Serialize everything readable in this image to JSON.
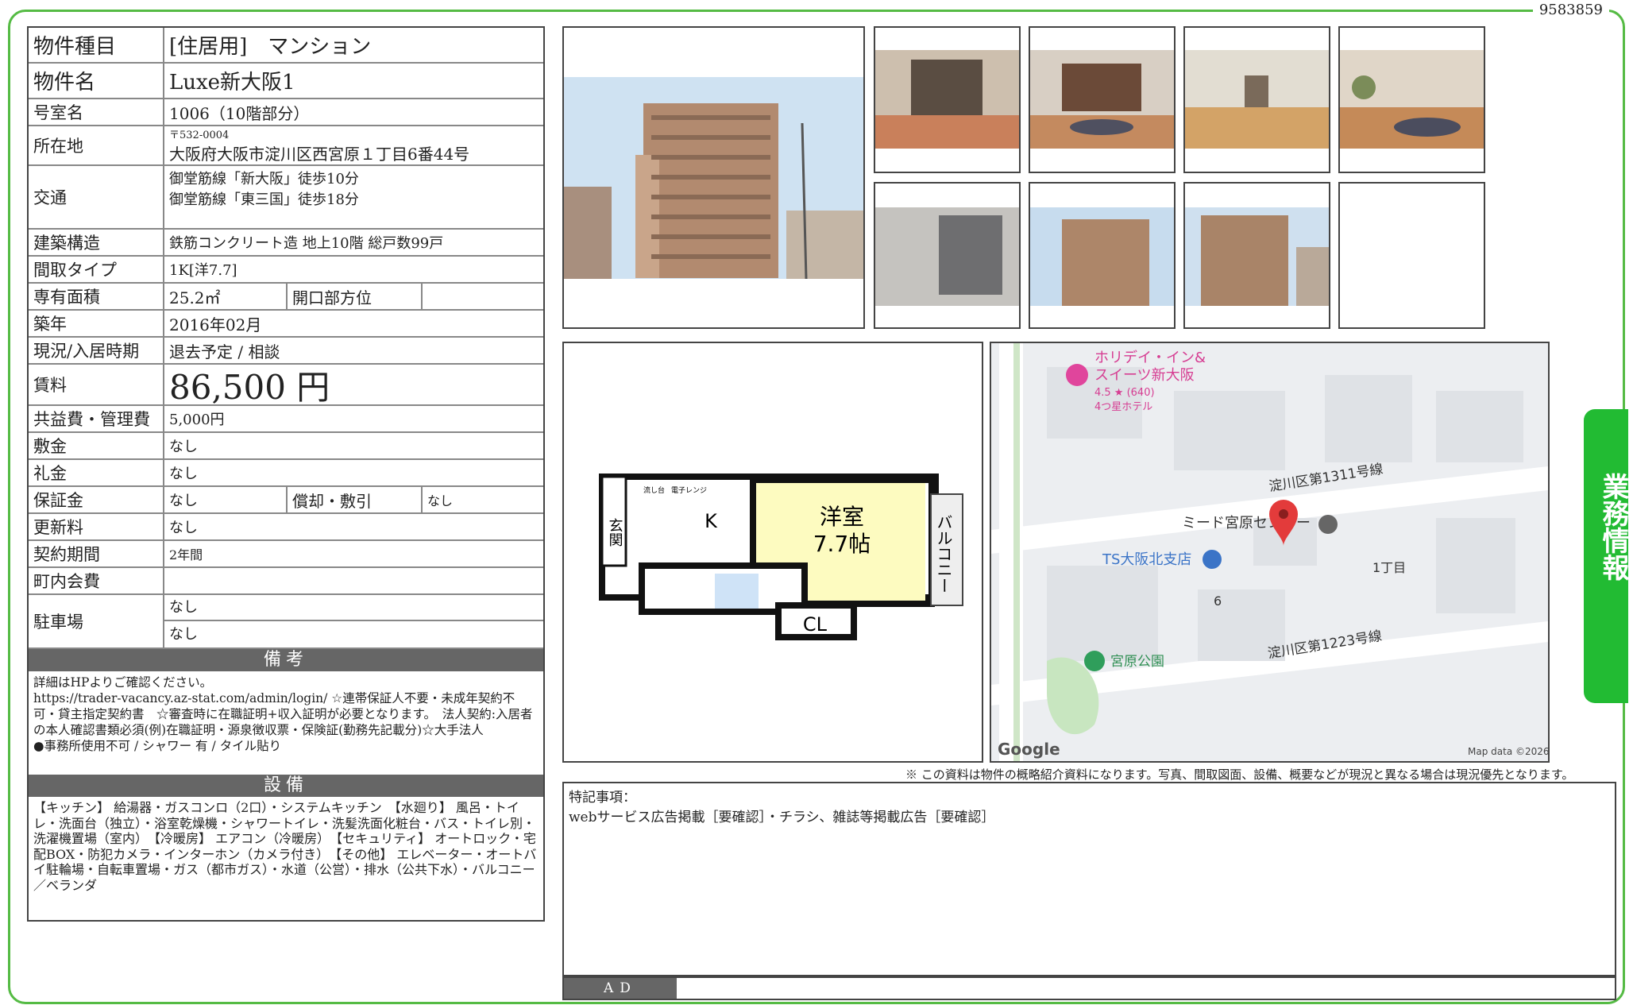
{
  "doc_id": "9583859",
  "side_tab": "業務情報",
  "property": {
    "type_label": "物件種目",
    "type_value": "[住居用]　マンション",
    "name_label": "物件名",
    "name_value": "Luxe新大阪1",
    "room_label": "号室名",
    "room_value": "1006（10階部分）",
    "address_label": "所在地",
    "zip": "〒532-0004",
    "address": "大阪府大阪市淀川区西宮原１丁目6番44号",
    "transport_label": "交通",
    "transport_1": "御堂筋線「新大阪」徒歩10分",
    "transport_2": "御堂筋線「東三国」徒歩18分",
    "structure_label": "建築構造",
    "structure_value": "鉄筋コンクリート造 地上10階 総戸数99戸",
    "layout_label": "間取タイプ",
    "layout_value": "1K[洋7.7]",
    "area_label": "専有面積",
    "area_value": "25.2㎡",
    "direction_label": "開口部方位",
    "direction_value": "",
    "built_label": "築年",
    "built_value": "2016年02月",
    "status_label": "現況/入居時期",
    "status_value": "退去予定 / 相談",
    "rent_label": "賃料",
    "rent_value": "86,500 円",
    "fee_label": "共益費・管理費",
    "fee_value": "5,000円",
    "deposit_label": "敷金",
    "deposit_value": "なし",
    "key_label": "礼金",
    "key_value": "なし",
    "guarantee_label": "保証金",
    "guarantee_value": "なし",
    "amort_label": "償却・敷引",
    "amort_value": "なし",
    "renewal_label": "更新料",
    "renewal_value": "なし",
    "contract_label": "契約期間",
    "contract_value": "2年間",
    "community_label": "町内会費",
    "community_value": "",
    "parking_label": "駐車場",
    "parking_value_1": "なし",
    "parking_value_2": "なし"
  },
  "notes": {
    "heading": "備考",
    "text": "詳細はHPよりご確認ください。\nhttps://trader-vacancy.az-stat.com/admin/login/ ☆連帯保証人不要・未成年契約不可・貸主指定契約書　☆審査時に在職証明+収入証明が必要となります。　法人契約:入居者の本人確認書類必須(例)在職証明・源泉徴収票・保険証(勤務先記載分)☆大手法人\n●事務所使用不可 / シャワー 有 / タイル貼り"
  },
  "equipment": {
    "heading": "設備",
    "text": "【キッチン】 給湯器・ガスコンロ（2口）・システムキッチン　【水廻り】 風呂・トイレ・洗面台（独立）・浴室乾燥機・シャワートイレ・洗髪洗面化粧台・バス・トイレ別・洗濯機置場（室内）　【冷暖房】 エアコン（冷暖房）　【セキュリティ】 オートロック・宅配BOX・防犯カメラ・インターホン（カメラ付き）　【その他】 エレベーター・オートバイ駐輪場・自転車置場・ガス（都市ガス）・水道（公営）・排水（公共下水）・バルコニー／ベランダ"
  },
  "floorplan": {
    "entrance": "玄関",
    "kitchen": "K",
    "room": "洋室",
    "room_size": "7.7帖",
    "closet": "CL",
    "balcony": "バルコニー",
    "sink_label": "流し台",
    "stove_label": "電子レンジ"
  },
  "map": {
    "hotel": "ホリデイ・イン&",
    "hotel2": "スイーツ新大阪",
    "hotel_rating": "4.5 ★ (640)",
    "hotel_class": "4つ星ホテル",
    "road1": "淀川区第1311号線",
    "road2": "淀川区第1223号線",
    "center": "ミード宮原センター",
    "bank": "TS大阪北支店",
    "chome": "1丁目",
    "block": "6",
    "park": "宮原公園",
    "logo": "Google",
    "credit": "Map data ©2026"
  },
  "disclaimer": "※ この資料は物件の概略紹介資料になります。写真、間取図面、設備、概要などが現況と異なる場合は現況優先となります。",
  "special": {
    "heading": "特記事項：",
    "text": "webサービス広告掲載［要確認］・チラシ、雑誌等掲載広告［要確認］"
  },
  "ad_label": "AD",
  "colors": {
    "frame": "#55bb44",
    "side_tab": "#22bb33",
    "header_bar": "#666666"
  }
}
